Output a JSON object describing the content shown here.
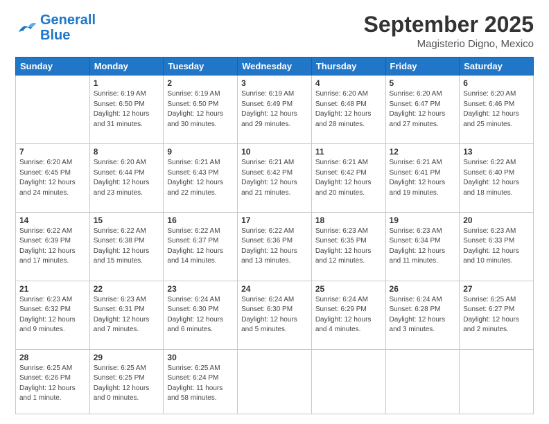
{
  "logo": {
    "line1": "General",
    "line2": "Blue"
  },
  "header": {
    "month": "September 2025",
    "location": "Magisterio Digno, Mexico"
  },
  "weekdays": [
    "Sunday",
    "Monday",
    "Tuesday",
    "Wednesday",
    "Thursday",
    "Friday",
    "Saturday"
  ],
  "weeks": [
    [
      {
        "day": "",
        "info": ""
      },
      {
        "day": "1",
        "info": "Sunrise: 6:19 AM\nSunset: 6:50 PM\nDaylight: 12 hours\nand 31 minutes."
      },
      {
        "day": "2",
        "info": "Sunrise: 6:19 AM\nSunset: 6:50 PM\nDaylight: 12 hours\nand 30 minutes."
      },
      {
        "day": "3",
        "info": "Sunrise: 6:19 AM\nSunset: 6:49 PM\nDaylight: 12 hours\nand 29 minutes."
      },
      {
        "day": "4",
        "info": "Sunrise: 6:20 AM\nSunset: 6:48 PM\nDaylight: 12 hours\nand 28 minutes."
      },
      {
        "day": "5",
        "info": "Sunrise: 6:20 AM\nSunset: 6:47 PM\nDaylight: 12 hours\nand 27 minutes."
      },
      {
        "day": "6",
        "info": "Sunrise: 6:20 AM\nSunset: 6:46 PM\nDaylight: 12 hours\nand 25 minutes."
      }
    ],
    [
      {
        "day": "7",
        "info": "Sunrise: 6:20 AM\nSunset: 6:45 PM\nDaylight: 12 hours\nand 24 minutes."
      },
      {
        "day": "8",
        "info": "Sunrise: 6:20 AM\nSunset: 6:44 PM\nDaylight: 12 hours\nand 23 minutes."
      },
      {
        "day": "9",
        "info": "Sunrise: 6:21 AM\nSunset: 6:43 PM\nDaylight: 12 hours\nand 22 minutes."
      },
      {
        "day": "10",
        "info": "Sunrise: 6:21 AM\nSunset: 6:42 PM\nDaylight: 12 hours\nand 21 minutes."
      },
      {
        "day": "11",
        "info": "Sunrise: 6:21 AM\nSunset: 6:42 PM\nDaylight: 12 hours\nand 20 minutes."
      },
      {
        "day": "12",
        "info": "Sunrise: 6:21 AM\nSunset: 6:41 PM\nDaylight: 12 hours\nand 19 minutes."
      },
      {
        "day": "13",
        "info": "Sunrise: 6:22 AM\nSunset: 6:40 PM\nDaylight: 12 hours\nand 18 minutes."
      }
    ],
    [
      {
        "day": "14",
        "info": "Sunrise: 6:22 AM\nSunset: 6:39 PM\nDaylight: 12 hours\nand 17 minutes."
      },
      {
        "day": "15",
        "info": "Sunrise: 6:22 AM\nSunset: 6:38 PM\nDaylight: 12 hours\nand 15 minutes."
      },
      {
        "day": "16",
        "info": "Sunrise: 6:22 AM\nSunset: 6:37 PM\nDaylight: 12 hours\nand 14 minutes."
      },
      {
        "day": "17",
        "info": "Sunrise: 6:22 AM\nSunset: 6:36 PM\nDaylight: 12 hours\nand 13 minutes."
      },
      {
        "day": "18",
        "info": "Sunrise: 6:23 AM\nSunset: 6:35 PM\nDaylight: 12 hours\nand 12 minutes."
      },
      {
        "day": "19",
        "info": "Sunrise: 6:23 AM\nSunset: 6:34 PM\nDaylight: 12 hours\nand 11 minutes."
      },
      {
        "day": "20",
        "info": "Sunrise: 6:23 AM\nSunset: 6:33 PM\nDaylight: 12 hours\nand 10 minutes."
      }
    ],
    [
      {
        "day": "21",
        "info": "Sunrise: 6:23 AM\nSunset: 6:32 PM\nDaylight: 12 hours\nand 9 minutes."
      },
      {
        "day": "22",
        "info": "Sunrise: 6:23 AM\nSunset: 6:31 PM\nDaylight: 12 hours\nand 7 minutes."
      },
      {
        "day": "23",
        "info": "Sunrise: 6:24 AM\nSunset: 6:30 PM\nDaylight: 12 hours\nand 6 minutes."
      },
      {
        "day": "24",
        "info": "Sunrise: 6:24 AM\nSunset: 6:30 PM\nDaylight: 12 hours\nand 5 minutes."
      },
      {
        "day": "25",
        "info": "Sunrise: 6:24 AM\nSunset: 6:29 PM\nDaylight: 12 hours\nand 4 minutes."
      },
      {
        "day": "26",
        "info": "Sunrise: 6:24 AM\nSunset: 6:28 PM\nDaylight: 12 hours\nand 3 minutes."
      },
      {
        "day": "27",
        "info": "Sunrise: 6:25 AM\nSunset: 6:27 PM\nDaylight: 12 hours\nand 2 minutes."
      }
    ],
    [
      {
        "day": "28",
        "info": "Sunrise: 6:25 AM\nSunset: 6:26 PM\nDaylight: 12 hours\nand 1 minute."
      },
      {
        "day": "29",
        "info": "Sunrise: 6:25 AM\nSunset: 6:25 PM\nDaylight: 12 hours\nand 0 minutes."
      },
      {
        "day": "30",
        "info": "Sunrise: 6:25 AM\nSunset: 6:24 PM\nDaylight: 11 hours\nand 58 minutes."
      },
      {
        "day": "",
        "info": ""
      },
      {
        "day": "",
        "info": ""
      },
      {
        "day": "",
        "info": ""
      },
      {
        "day": "",
        "info": ""
      }
    ]
  ]
}
